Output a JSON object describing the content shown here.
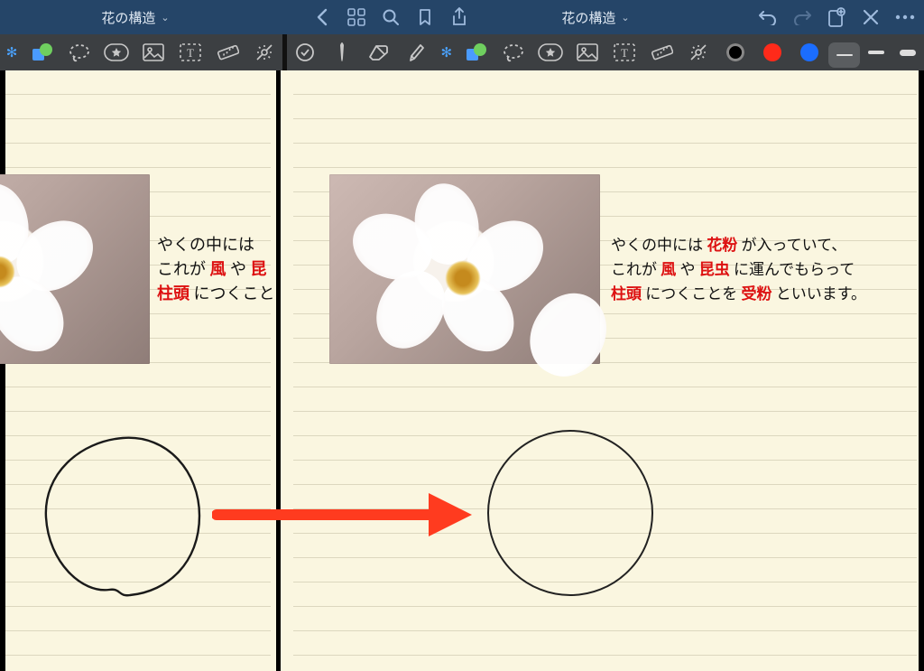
{
  "nav": {
    "title_left": "花の構造",
    "title_right": "花の構造"
  },
  "icons": {
    "back": "‹",
    "grid": "grid",
    "search": "search",
    "bookmark": "bookmark",
    "share": "share",
    "undo": "↶",
    "redo": "↷",
    "newpage": "⊕",
    "close": "×",
    "more": "⋯"
  },
  "toolbar": {
    "shape_tool": "shape",
    "lasso": "lasso",
    "favorites": "star",
    "image": "image",
    "text": "T",
    "ruler": "ruler",
    "laser": "laser",
    "pen": "pen",
    "eraser": "eraser",
    "highlighter": "highlighter"
  },
  "colors": {
    "black": "#000000",
    "red": "#ff2a1a",
    "blue": "#1b6dff"
  },
  "note_left": {
    "line1_a": "やくの中には",
    "line2_a": "これが",
    "line2_b": "風",
    "line2_c": "や",
    "line2_d": "昆",
    "line3_a": "柱頭",
    "line3_b": "につくこと"
  },
  "note_right": {
    "line1_a": "やくの中には",
    "line1_b": "花粉",
    "line1_c": "が入っていて、",
    "line2_a": "これが",
    "line2_b": "風",
    "line2_c": "や",
    "line2_d": "昆虫",
    "line2_e": "に運んでもらって",
    "line3_a": "柱頭",
    "line3_b": "につくことを",
    "line3_c": "受粉",
    "line3_d": "といいます。"
  }
}
